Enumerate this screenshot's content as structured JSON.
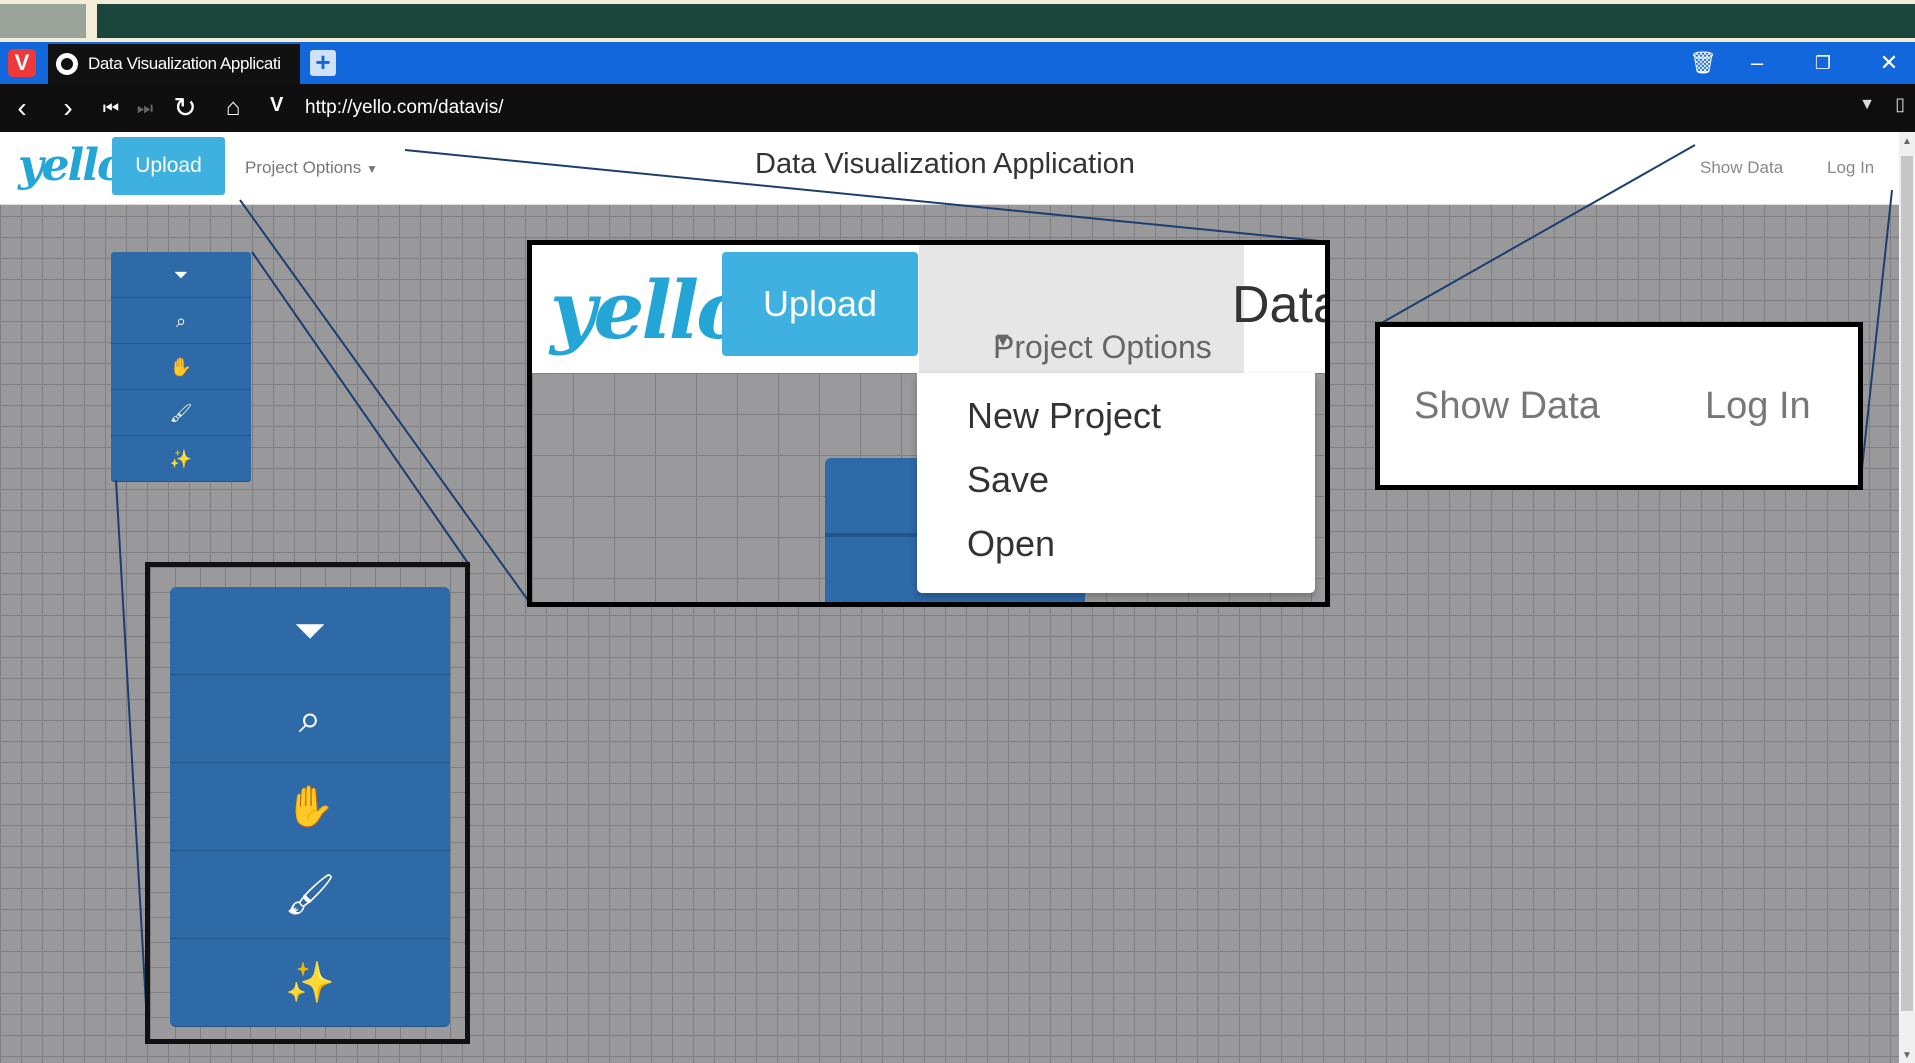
{
  "browser": {
    "tab_title": "Data Visualization Applicati",
    "url": "http://yello.com/datavis/",
    "new_tab_icon": "plus-icon",
    "controls": [
      "back-icon",
      "forward-icon",
      "rewind-icon",
      "fast-forward-icon",
      "reload-icon",
      "home-icon"
    ]
  },
  "app": {
    "logo": "yello",
    "upload_label": "Upload",
    "project_options_label": "Project Options",
    "title": "Data Visualization Application",
    "show_data_label": "Show Data",
    "login_label": "Log In"
  },
  "toolbar": {
    "tools": [
      "filter-icon",
      "search-icon",
      "hand-icon",
      "brush-icon",
      "magic-wand-icon"
    ]
  },
  "zoom_dropdown": {
    "logo": "yello",
    "upload_label": "Upload",
    "project_options_label": "Project Options",
    "title_fragment": "Data",
    "menu_items": [
      "New Project",
      "Save",
      "Open"
    ]
  },
  "zoom_auth": {
    "show_data_label": "Show Data",
    "login_label": "Log In"
  },
  "colors": {
    "brand": "#23a5d6",
    "upload_button": "#3fb1e0",
    "tool_button": "#2f6aa8",
    "tabbar": "#1267dd"
  }
}
